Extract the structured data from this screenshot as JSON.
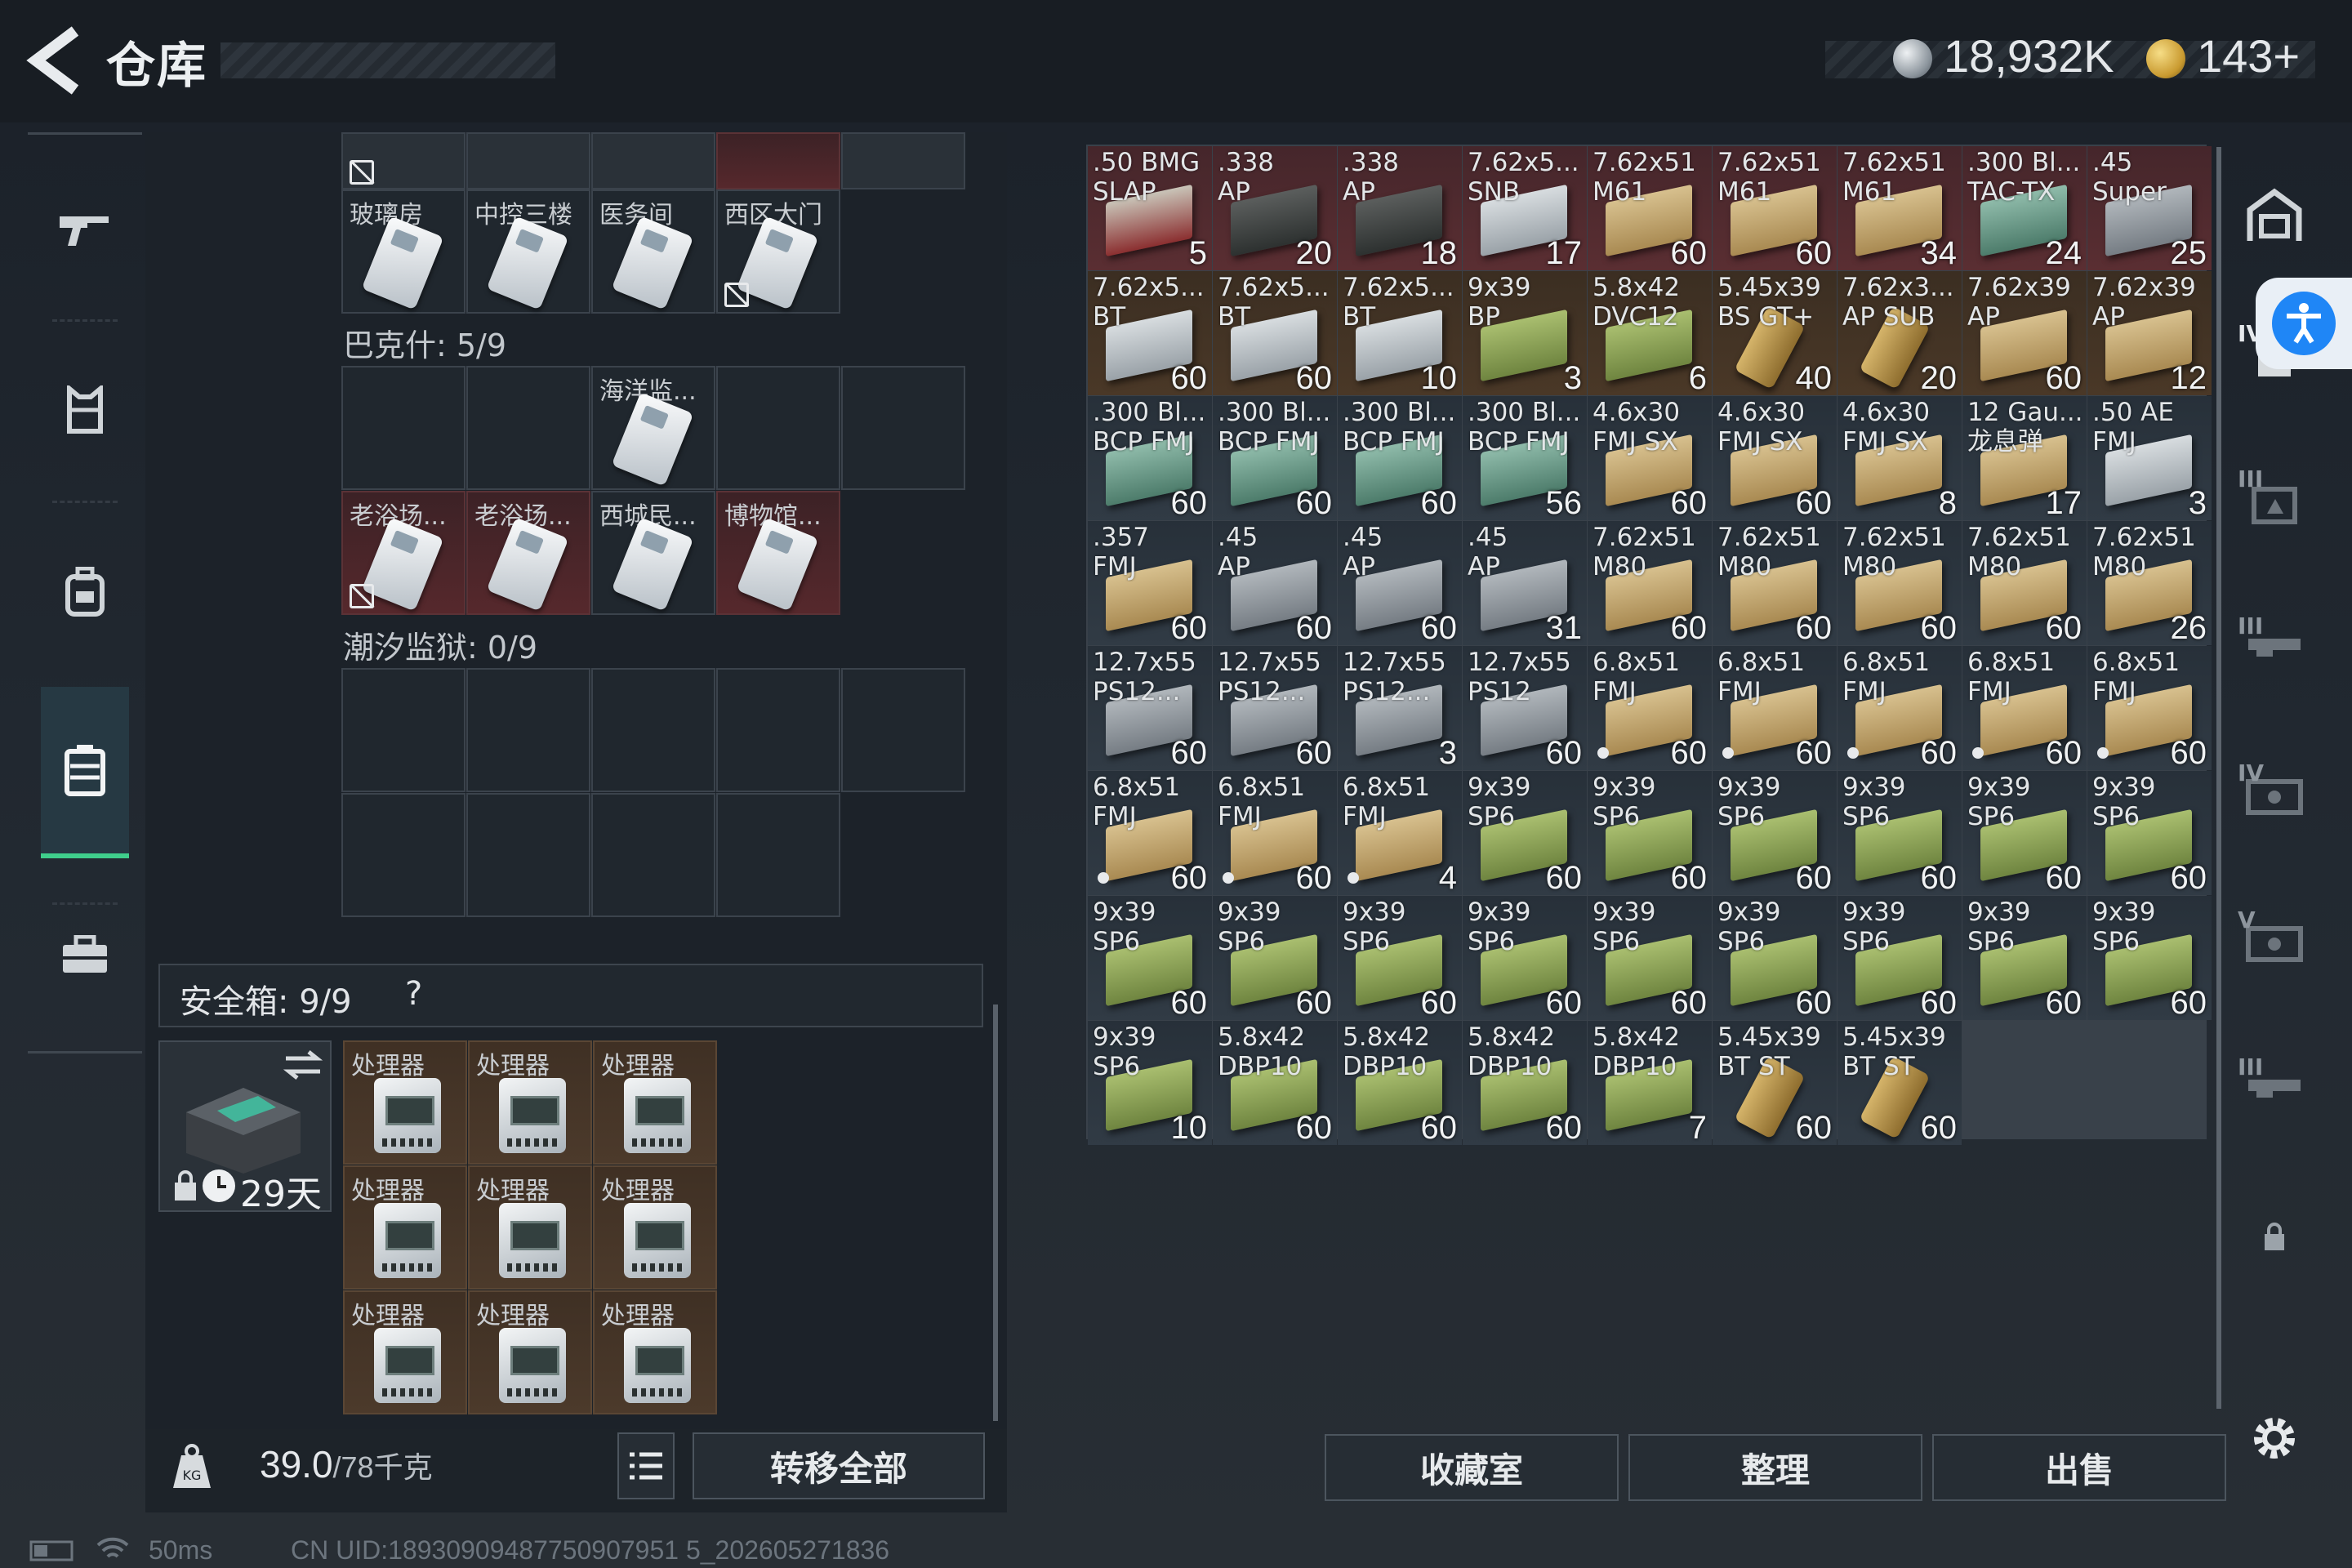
{
  "header": {
    "title": "仓库",
    "silver": "18,932K",
    "gold": "143+"
  },
  "keycards": {
    "group1_labels": [
      "玻璃房",
      "中控三楼",
      "医务间",
      "西区大门"
    ],
    "bakshi_label": "巴克什: 5/9",
    "bakshi_row1": [
      "海洋监..."
    ],
    "bakshi_row2": [
      "老浴场...",
      "老浴场...",
      "西城民...",
      "博物馆..."
    ],
    "prison_label": "潮汐监狱: 0/9"
  },
  "safebox": {
    "label": "安全箱:  9/9",
    "help": "?",
    "days": "29天",
    "items": [
      "处理器",
      "处理器",
      "处理器",
      "处理器",
      "处理器",
      "处理器",
      "处理器",
      "处理器",
      "处理器"
    ]
  },
  "footer": {
    "weight": "39.0",
    "weight_max": "/78千克",
    "transfer_all": "转移全部"
  },
  "actions": {
    "collection": "收藏室",
    "organize": "整理",
    "sell": "出售"
  },
  "ammo": [
    {
      "n": ".50 BMG\nSLAP",
      "c": "5",
      "bg": "red",
      "box": "redb"
    },
    {
      "n": ".338\nAP",
      "c": "20",
      "bg": "red",
      "box": "dark"
    },
    {
      "n": ".338\nAP",
      "c": "18",
      "bg": "red",
      "box": "dark"
    },
    {
      "n": "7.62x5...\nSNB",
      "c": "17",
      "bg": "red",
      "box": "silver"
    },
    {
      "n": "7.62x51\nM61",
      "c": "60",
      "bg": "red",
      "box": "tan"
    },
    {
      "n": "7.62x51\nM61",
      "c": "60",
      "bg": "red",
      "box": "tan"
    },
    {
      "n": "7.62x51\nM61",
      "c": "34",
      "bg": "red",
      "box": "tan"
    },
    {
      "n": ".300 Bl...\nTAC-TX",
      "c": "24",
      "bg": "red",
      "box": "teal"
    },
    {
      "n": ".45\nSuper",
      "c": "25",
      "bg": "red",
      "box": "gray"
    },
    {
      "n": "7.62x5...\nBT",
      "c": "60",
      "bg": "orange",
      "box": "silver"
    },
    {
      "n": "7.62x5...\nBT",
      "c": "60",
      "bg": "orange",
      "box": "silver"
    },
    {
      "n": "7.62x5...\nBT",
      "c": "10",
      "bg": "orange",
      "box": "silver"
    },
    {
      "n": "9x39\nBP",
      "c": "3",
      "bg": "orange",
      "box": "olive"
    },
    {
      "n": "5.8x42\nDVC12",
      "c": "6",
      "bg": "orange",
      "box": "olive"
    },
    {
      "n": "5.45x39\nBS GT+",
      "c": "40",
      "bg": "orange",
      "box": "brass"
    },
    {
      "n": "7.62x3...\nAP SUB",
      "c": "20",
      "bg": "orange",
      "box": "brass"
    },
    {
      "n": "7.62x39\nAP",
      "c": "60",
      "bg": "orange",
      "box": "tan"
    },
    {
      "n": "7.62x39\nAP",
      "c": "12",
      "bg": "orange",
      "box": "tan"
    },
    {
      "n": ".300 Bl...\nBCP FMJ",
      "c": "60",
      "bg": "blue",
      "box": "teal"
    },
    {
      "n": ".300 Bl...\nBCP FMJ",
      "c": "60",
      "bg": "blue",
      "box": "teal"
    },
    {
      "n": ".300 Bl...\nBCP FMJ",
      "c": "60",
      "bg": "blue",
      "box": "teal"
    },
    {
      "n": ".300 Bl...\nBCP FMJ",
      "c": "56",
      "bg": "blue",
      "box": "teal"
    },
    {
      "n": "4.6x30\nFMJ SX",
      "c": "60",
      "bg": "blue",
      "box": "tan"
    },
    {
      "n": "4.6x30\nFMJ SX",
      "c": "60",
      "bg": "blue",
      "box": "tan"
    },
    {
      "n": "4.6x30\nFMJ SX",
      "c": "8",
      "bg": "blue",
      "box": "tan"
    },
    {
      "n": "12 Gau...\n龙息弹",
      "c": "17",
      "bg": "blue",
      "box": "tan"
    },
    {
      "n": ".50 AE\nFMJ",
      "c": "3",
      "bg": "blue",
      "box": "silver"
    },
    {
      "n": ".357\nFMJ",
      "c": "60",
      "bg": "blue",
      "box": "tan"
    },
    {
      "n": ".45\nAP",
      "c": "60",
      "bg": "blue",
      "box": "gray"
    },
    {
      "n": ".45\nAP",
      "c": "60",
      "bg": "blue",
      "box": "gray"
    },
    {
      "n": ".45\nAP",
      "c": "31",
      "bg": "blue",
      "box": "gray"
    },
    {
      "n": "7.62x51\nM80",
      "c": "60",
      "bg": "blue",
      "box": "tan"
    },
    {
      "n": "7.62x51\nM80",
      "c": "60",
      "bg": "blue",
      "box": "tan"
    },
    {
      "n": "7.62x51\nM80",
      "c": "60",
      "bg": "blue",
      "box": "tan"
    },
    {
      "n": "7.62x51\nM80",
      "c": "60",
      "bg": "blue",
      "box": "tan"
    },
    {
      "n": "7.62x51\nM80",
      "c": "26",
      "bg": "blue",
      "box": "tan"
    },
    {
      "n": "12.7x55\nPS12...",
      "c": "60",
      "bg": "blue",
      "box": "gray"
    },
    {
      "n": "12.7x55\nPS12...",
      "c": "60",
      "bg": "blue",
      "box": "gray"
    },
    {
      "n": "12.7x55\nPS12...",
      "c": "3",
      "bg": "blue",
      "box": "gray"
    },
    {
      "n": "12.7x55\nPS12",
      "c": "60",
      "bg": "blue",
      "box": "gray"
    },
    {
      "n": "6.8x51\nFMJ",
      "c": "60",
      "bg": "blue",
      "box": "tan",
      "dot": true
    },
    {
      "n": "6.8x51\nFMJ",
      "c": "60",
      "bg": "blue",
      "box": "tan",
      "dot": true
    },
    {
      "n": "6.8x51\nFMJ",
      "c": "60",
      "bg": "blue",
      "box": "tan",
      "dot": true
    },
    {
      "n": "6.8x51\nFMJ",
      "c": "60",
      "bg": "blue",
      "box": "tan",
      "dot": true
    },
    {
      "n": "6.8x51\nFMJ",
      "c": "60",
      "bg": "blue",
      "box": "tan",
      "dot": true
    },
    {
      "n": "6.8x51\nFMJ",
      "c": "60",
      "bg": "blue",
      "box": "tan",
      "dot": true
    },
    {
      "n": "6.8x51\nFMJ",
      "c": "60",
      "bg": "blue",
      "box": "tan",
      "dot": true
    },
    {
      "n": "6.8x51\nFMJ",
      "c": "4",
      "bg": "blue",
      "box": "tan",
      "dot": true
    },
    {
      "n": "9x39\nSP6",
      "c": "60",
      "bg": "blue",
      "box": "olive"
    },
    {
      "n": "9x39\nSP6",
      "c": "60",
      "bg": "blue",
      "box": "olive"
    },
    {
      "n": "9x39\nSP6",
      "c": "60",
      "bg": "blue",
      "box": "olive"
    },
    {
      "n": "9x39\nSP6",
      "c": "60",
      "bg": "blue",
      "box": "olive"
    },
    {
      "n": "9x39\nSP6",
      "c": "60",
      "bg": "blue",
      "box": "olive"
    },
    {
      "n": "9x39\nSP6",
      "c": "60",
      "bg": "blue",
      "box": "olive"
    },
    {
      "n": "9x39\nSP6",
      "c": "60",
      "bg": "blue",
      "box": "olive"
    },
    {
      "n": "9x39\nSP6",
      "c": "60",
      "bg": "blue",
      "box": "olive"
    },
    {
      "n": "9x39\nSP6",
      "c": "60",
      "bg": "blue",
      "box": "olive"
    },
    {
      "n": "9x39\nSP6",
      "c": "60",
      "bg": "blue",
      "box": "olive"
    },
    {
      "n": "9x39\nSP6",
      "c": "60",
      "bg": "blue",
      "box": "olive"
    },
    {
      "n": "9x39\nSP6",
      "c": "60",
      "bg": "blue",
      "box": "olive"
    },
    {
      "n": "9x39\nSP6",
      "c": "60",
      "bg": "blue",
      "box": "olive"
    },
    {
      "n": "9x39\nSP6",
      "c": "60",
      "bg": "blue",
      "box": "olive"
    },
    {
      "n": "9x39\nSP6",
      "c": "60",
      "bg": "blue",
      "box": "olive"
    },
    {
      "n": "9x39\nSP6",
      "c": "10",
      "bg": "blue",
      "box": "olive"
    },
    {
      "n": "5.8x42\nDBP10",
      "c": "60",
      "bg": "blue",
      "box": "olive"
    },
    {
      "n": "5.8x42\nDBP10",
      "c": "60",
      "bg": "blue",
      "box": "olive"
    },
    {
      "n": "5.8x42\nDBP10",
      "c": "60",
      "bg": "blue",
      "box": "olive"
    },
    {
      "n": "5.8x42\nDBP10",
      "c": "7",
      "bg": "blue",
      "box": "olive"
    },
    {
      "n": "5.45x39\nBT ST",
      "c": "60",
      "bg": "blue",
      "box": "brass"
    },
    {
      "n": "5.45x39\nBT ST",
      "c": "60",
      "bg": "blue",
      "box": "brass"
    }
  ],
  "right_tabs": [
    "IV",
    "III",
    "III",
    "IV",
    "V",
    "III"
  ],
  "status": {
    "ping": "50ms",
    "uid": "CN UID:18930909487750907951 5_202605271836"
  },
  "colors": {
    "accent_green": "#3fcf8c",
    "rare_red": "#5a2e32",
    "epic_orange": "#4a3827"
  }
}
